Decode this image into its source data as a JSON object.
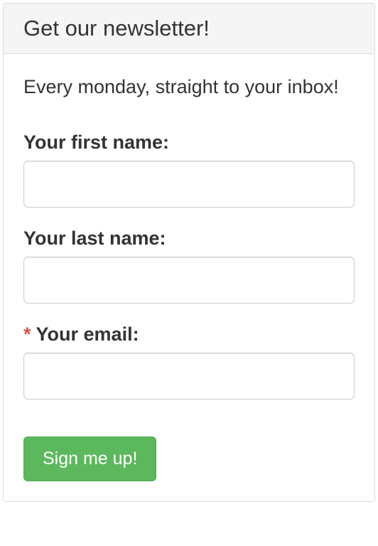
{
  "panel": {
    "title": "Get our newsletter!",
    "subtitle": "Every monday, straight to your inbox!"
  },
  "form": {
    "required_mark": "*",
    "first_name": {
      "label": "Your first name:",
      "value": ""
    },
    "last_name": {
      "label": "Your last name:",
      "value": ""
    },
    "email": {
      "label": "Your email:",
      "value": ""
    },
    "submit_label": "Sign me up!"
  }
}
